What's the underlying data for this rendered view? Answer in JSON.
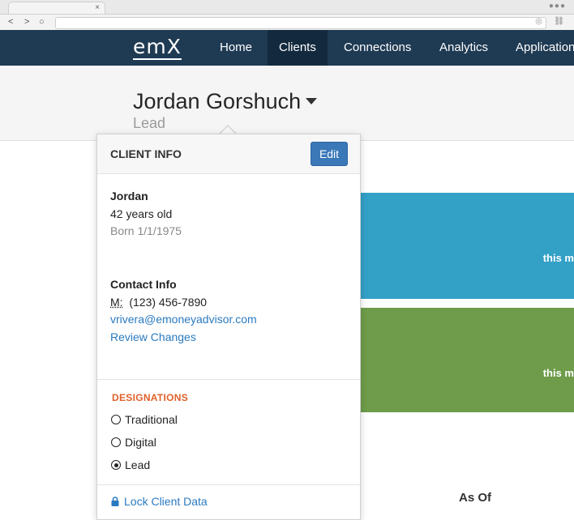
{
  "browser": {
    "tab_close": "×",
    "back": "<",
    "forward": ">",
    "reload": "○",
    "window_dots": "●●●"
  },
  "nav": {
    "logo": "emX",
    "links": [
      "Home",
      "Clients",
      "Connections",
      "Analytics",
      "Applications"
    ],
    "active": "Clients"
  },
  "header": {
    "name": "Jordan Gorshuch",
    "status": "Lead"
  },
  "cards": {
    "blue_text": "this m",
    "green_text": "this m",
    "as_of_label": "As Of"
  },
  "popover": {
    "title": "CLIENT INFO",
    "edit_label": "Edit",
    "first_name": "Jordan",
    "age": "42 years old",
    "born": "Born 1/1/1975",
    "contact_heading": "Contact Info",
    "phone_label": "M:",
    "phone": "(123) 456-7890",
    "email": "vrivera@emoneyadvisor.com",
    "review_changes": "Review Changes",
    "designations_title": "DESIGNATIONS",
    "designations": [
      {
        "label": "Traditional",
        "selected": false
      },
      {
        "label": "Digital",
        "selected": false
      },
      {
        "label": "Lead",
        "selected": true
      }
    ],
    "lock_label": "Lock Client Data"
  },
  "colors": {
    "nav_bg": "#1f3a53",
    "card_blue": "#33a0c6",
    "card_green": "#6e9c4a",
    "designations_title": "#e0602a",
    "link": "#2a7ac0",
    "edit_button": "#3a78b8"
  }
}
